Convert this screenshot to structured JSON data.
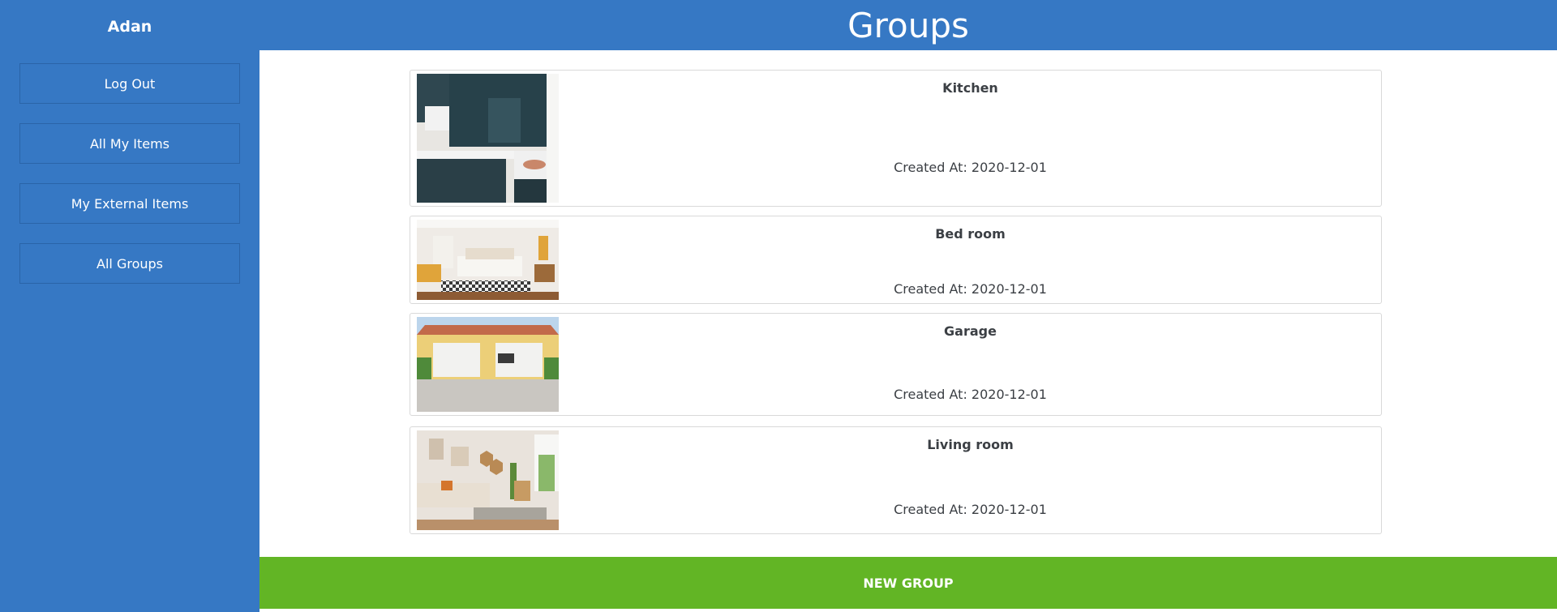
{
  "sidebar": {
    "user_name": "Adan",
    "items": [
      {
        "label": "Log Out"
      },
      {
        "label": "All My Items"
      },
      {
        "label": "My External Items"
      },
      {
        "label": "All Groups"
      }
    ]
  },
  "header": {
    "title": "Groups"
  },
  "groups": [
    {
      "name": "Kitchen",
      "created": "Created At: 2020-12-01",
      "image": "kitchen-photo"
    },
    {
      "name": "Bed room",
      "created": "Created At: 2020-12-01",
      "image": "bedroom-photo"
    },
    {
      "name": "Garage",
      "created": "Created At: 2020-12-01",
      "image": "garage-photo"
    },
    {
      "name": "Living room",
      "created": "Created At: 2020-12-01",
      "image": "living-room-photo"
    }
  ],
  "actions": {
    "new_group_label": "NEW GROUP"
  },
  "colors": {
    "primary": "#3678c4",
    "accent": "#62b525"
  }
}
